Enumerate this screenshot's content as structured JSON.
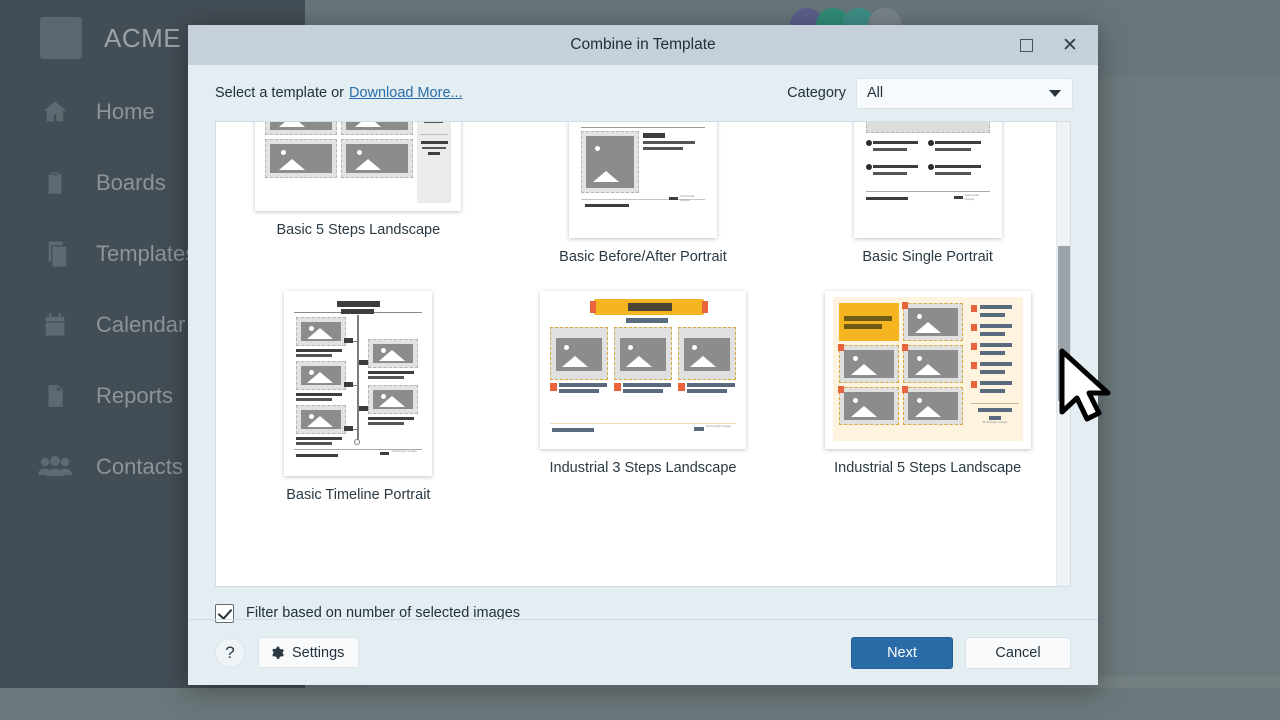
{
  "app": {
    "brand": "ACME",
    "sidebar_items": [
      {
        "label": "Home",
        "icon": "home-icon"
      },
      {
        "label": "Boards",
        "icon": "clipboard-icon"
      },
      {
        "label": "Templates",
        "icon": "copy-icon"
      },
      {
        "label": "Calendar",
        "icon": "calendar-icon"
      },
      {
        "label": "Reports",
        "icon": "document-icon"
      },
      {
        "label": "Contacts",
        "icon": "people-icon"
      }
    ],
    "avatar_colors": [
      "#5b5f8c",
      "#2f8d77",
      "#3e8f86",
      "#7a858a"
    ]
  },
  "dialog": {
    "title": "Combine in Template",
    "window_controls": {
      "maximize": "maximize-icon",
      "close": "✕"
    },
    "header": {
      "select_text": "Select a template or",
      "download_more": "Download More...",
      "category_label": "Category",
      "category_value": "All",
      "category_options": [
        "All"
      ]
    },
    "templates": [
      {
        "name": "Basic 5 Steps Landscape",
        "orientation": "landscape",
        "style": "basic5"
      },
      {
        "name": "Basic Before/After Portrait",
        "orientation": "portrait",
        "style": "beforeafter"
      },
      {
        "name": "Basic Single Portrait",
        "orientation": "portrait",
        "style": "single"
      },
      {
        "name": "Basic Timeline Portrait",
        "orientation": "portrait",
        "style": "timeline"
      },
      {
        "name": "Industrial 3 Steps Landscape",
        "orientation": "landscape",
        "style": "ind3"
      },
      {
        "name": "Industrial 5 Steps Landscape",
        "orientation": "landscape",
        "style": "ind5"
      }
    ],
    "filter": {
      "label": "Filter based on number of selected images",
      "checked": true
    },
    "footer": {
      "help_label": "?",
      "settings_label": "Settings",
      "next_label": "Next",
      "cancel_label": "Cancel"
    },
    "accent_color": "#2a6ca8"
  }
}
